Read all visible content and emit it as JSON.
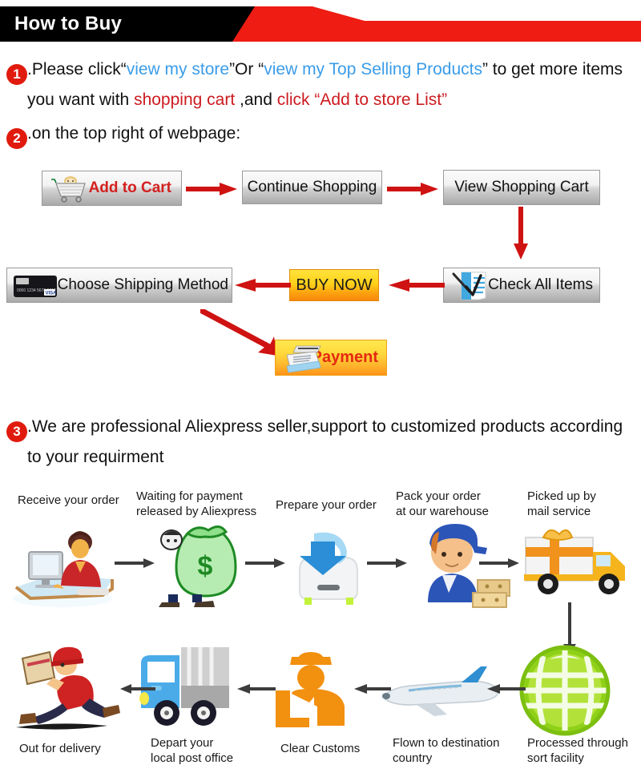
{
  "banner": {
    "title": "How to Buy",
    "black_color": "#000000",
    "red_color": "#ee1c13"
  },
  "steps": [
    {
      "number": "1",
      "line1": [
        {
          "text": ".Please click“",
          "style": "black"
        },
        {
          "text": "view my store",
          "style": "blue"
        },
        {
          "text": "”Or “",
          "style": "black"
        },
        {
          "text": "view my Top Selling Products",
          "style": "blue"
        },
        {
          "text": "” to get more items",
          "style": "black"
        }
      ],
      "line2": [
        {
          "text": "you want with ",
          "style": "black"
        },
        {
          "text": "shopping cart",
          "style": "red"
        },
        {
          "text": " ,and ",
          "style": "black"
        },
        {
          "text": "click “Add to store List”",
          "style": "red"
        }
      ]
    },
    {
      "number": "2",
      "line1": [
        {
          "text": ".on the top right of webpage:",
          "style": "black"
        }
      ]
    },
    {
      "number": "3",
      "line1": [
        {
          "text": ".We are professional Aliexpress seller,support to customized products according",
          "style": "black"
        }
      ],
      "line2": [
        {
          "text": "to your requirment",
          "style": "black"
        }
      ]
    }
  ],
  "flow": {
    "buttons": {
      "add_to_cart": "Add to Cart",
      "continue_shopping": "Continue Shopping",
      "view_shopping_cart": "View Shopping Cart",
      "choose_shipping_method": "Choose Shipping Method",
      "buy_now": "BUY NOW",
      "check_all_items": "Check All Items",
      "payment": "Payment"
    },
    "arrow_color": "#cf1212"
  },
  "shipping": {
    "arrow_color": "#3c3c3c",
    "row1": [
      {
        "label": "Receive your order",
        "icon": "person-at-computer-icon"
      },
      {
        "label": "Waiting for payment\nreleased by Aliexpress",
        "icon": "money-bag-icon"
      },
      {
        "label": "Prepare your order",
        "icon": "download-box-icon"
      },
      {
        "label": "Pack your order\nat our warehouse",
        "icon": "worker-with-boxes-icon"
      },
      {
        "label": "Picked up by\nmail service",
        "icon": "delivery-truck-gift-icon"
      }
    ],
    "row2": [
      {
        "label": "Out for delivery",
        "icon": "running-courier-icon"
      },
      {
        "label": "Depart your\nlocal post office",
        "icon": "blue-post-truck-icon"
      },
      {
        "label": "Clear Customs",
        "icon": "customs-officer-icon"
      },
      {
        "label": "Flown to destination\ncountry",
        "icon": "airplane-icon"
      },
      {
        "label": "Processed through\nsort facility",
        "icon": "green-globe-icon"
      }
    ]
  }
}
